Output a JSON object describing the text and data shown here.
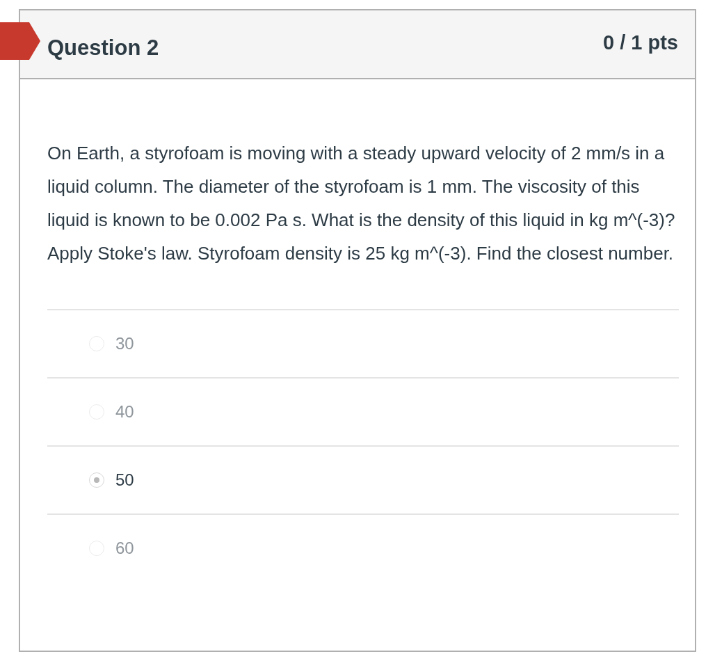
{
  "question": {
    "title": "Question 2",
    "points": "0 / 1 pts",
    "flagged": true,
    "text": "On Earth, a styrofoam is moving with a steady upward velocity of 2 mm/s in a liquid column. The diameter of the styrofoam is 1 mm. The viscosity of this liquid is known to be 0.002 Pa s. What is the density of this liquid in kg m^(-3)? Apply Stoke's law. Styrofoam density is 25 kg m^(-3). Find the closest number.",
    "answers": [
      {
        "label": "30",
        "selected": false
      },
      {
        "label": "40",
        "selected": false
      },
      {
        "label": "50",
        "selected": true
      },
      {
        "label": "60",
        "selected": false
      }
    ]
  }
}
